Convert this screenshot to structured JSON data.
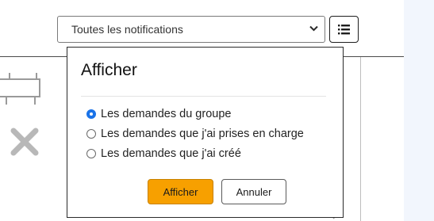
{
  "filter": {
    "selected": "Toutes les notifications",
    "chevron_icon": "chevron-down-icon"
  },
  "toolbar": {
    "list_icon": "list-icon"
  },
  "popover": {
    "title": "Afficher",
    "options": [
      {
        "label": "Les demandes du groupe",
        "checked": true
      },
      {
        "label": "Les demandes que j'ai prises en charge",
        "checked": false
      },
      {
        "label": "Les demandes que j'ai créé",
        "checked": false
      }
    ],
    "confirm_label": "Afficher",
    "cancel_label": "Annuler"
  },
  "colors": {
    "primary_button": "#f7a000",
    "radio_checked": "#1a73e8",
    "right_pane": "#f2f6fd"
  }
}
